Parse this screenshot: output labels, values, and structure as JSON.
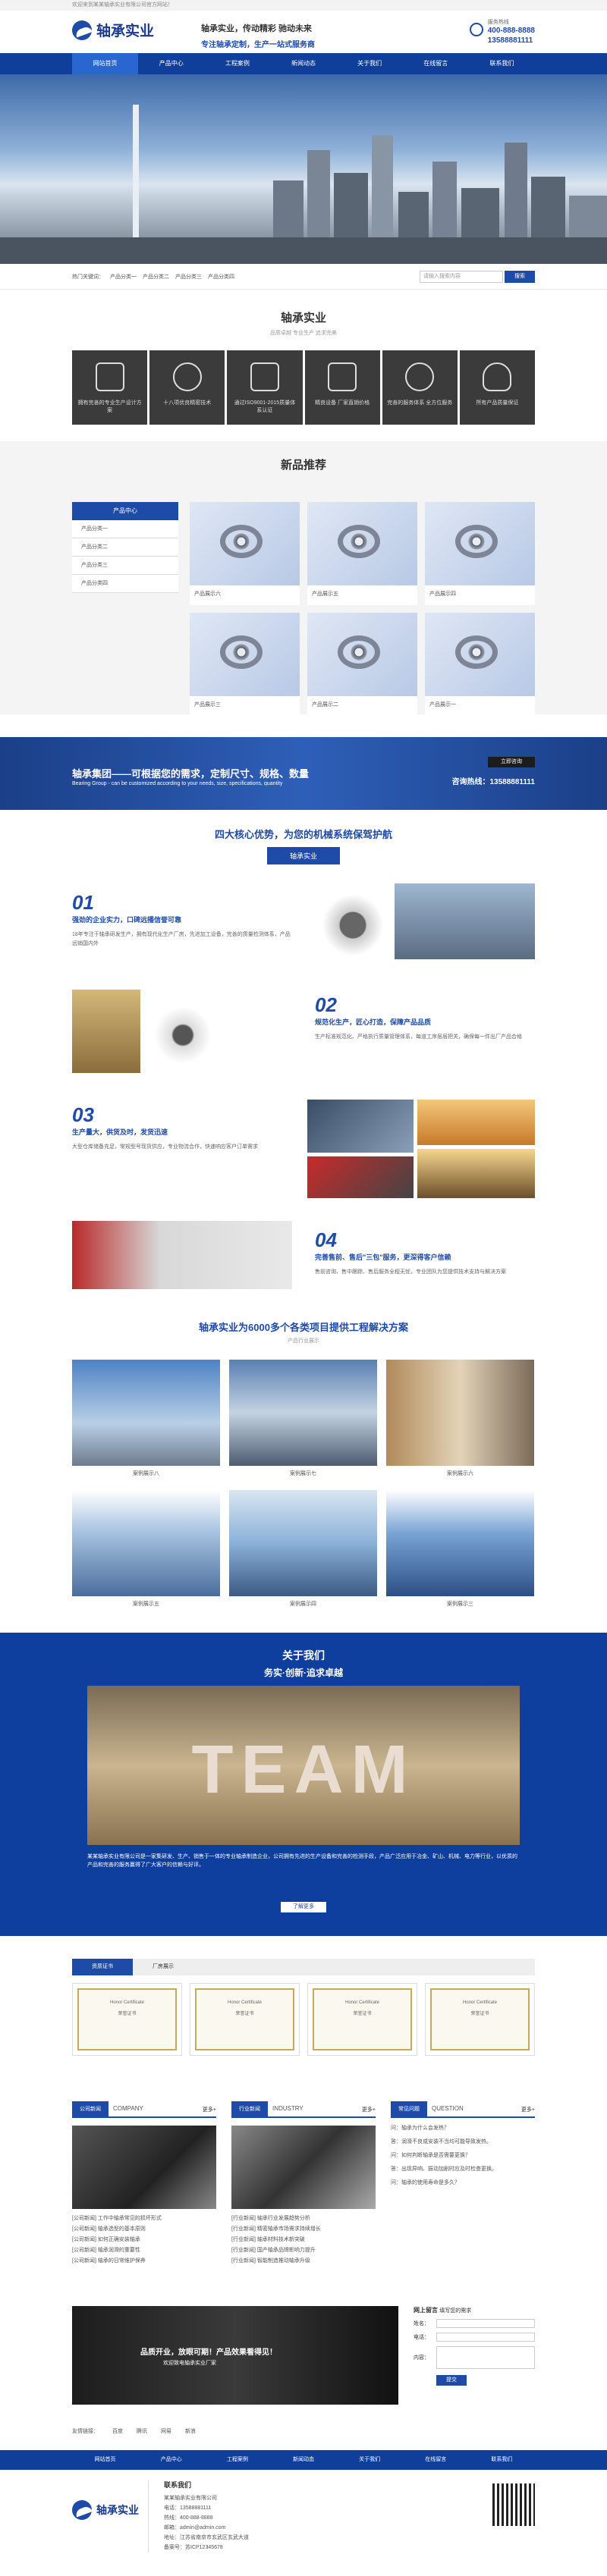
{
  "topbar": {
    "text": "欢迎来到某某轴承实业有限公司官方网站！"
  },
  "header": {
    "brand": "轴承实业",
    "slogan1": "轴承实业，传动精彩 驰动未来",
    "slogan2": "专注轴承定制，生产一站式服务商",
    "hotline_label": "服务热线",
    "phone1": "400-888-8888",
    "phone2": "13588881111"
  },
  "nav": [
    "网站首页",
    "产品中心",
    "工程案例",
    "新闻动态",
    "关于我们",
    "在线留言",
    "联系我们"
  ],
  "search": {
    "hot_label": "热门关键词：",
    "keywords": [
      "产品分类一",
      "产品分类二",
      "产品分类三",
      "产品分类四"
    ],
    "placeholder": "请输入搜索内容",
    "button": "搜索"
  },
  "intro": {
    "title": "轴承实业",
    "subtitle": "品质卓越 专业生产 追求完美",
    "features": [
      "拥有完善的专业生产设计方案",
      "十八项优良精密技术",
      "通过ISO9001-2015质量体系认证",
      "精良设备 厂家直销价格",
      "完善的服务体系 全方位服务",
      "所有产品质量保证"
    ]
  },
  "products": {
    "title": "新品推荐",
    "category_head": "产品中心",
    "categories": [
      "产品分类一",
      "产品分类二",
      "产品分类三",
      "产品分类四"
    ],
    "items": [
      "产品展示六",
      "产品展示五",
      "产品展示四",
      "产品展示三",
      "产品展示二",
      "产品展示一"
    ]
  },
  "band": {
    "title": "轴承集团——可根据您的需求，定制尺寸、规格、数量",
    "sub": "Bearing Group - can be customized according to your needs, size, specifications, quantity",
    "consult": "立即咨询",
    "phone_label": "咨询热线：",
    "phone": "13588881111"
  },
  "advantages": {
    "title": "四大核心优势，为您的机械系统保驾护航",
    "pill": "轴承实业",
    "items": [
      {
        "num": "01",
        "h": "强劲的企业实力，口碑远播信誉可靠",
        "p": "18年专注于轴承研发生产，拥有现代化生产厂房，先进加工设备，完善的质量检测体系，产品远销国内外"
      },
      {
        "num": "02",
        "h": "规范化生产，匠心打造，保障产品品质",
        "p": "生产标准规范化、严格执行质量管理体系，每道工序层层把关，确保每一件出厂产品合格"
      },
      {
        "num": "03",
        "h": "生产量大，供货及时，发货迅速",
        "p": "大型仓库储备充足，常规型号现货供应，专业物流合作，快速响应客户订单需求"
      },
      {
        "num": "04",
        "h": "完善售前、售后\"三包\"服务，更深得客户信赖",
        "p": "售前咨询、售中跟踪、售后服务全程无忧，专业团队为您提供技术支持与解决方案"
      }
    ]
  },
  "cases": {
    "title": "轴承实业为6000多个各类项目提供工程解决方案",
    "sub": "产品行业展示",
    "items": [
      "案例展示八",
      "案例展示七",
      "案例展示六",
      "案例展示五",
      "案例展示四",
      "案例展示三"
    ]
  },
  "about": {
    "title": "关于我们",
    "tag": "务实·创新·追求卓越",
    "image_text": "TEAM",
    "desc": "某某轴承实业有限公司是一家集研发、生产、销售于一体的专业轴承制造企业，公司拥有先进的生产设备和完善的检测手段，产品广泛应用于冶金、矿山、机械、电力等行业，以优质的产品和完善的服务赢得了广大客户的信赖与好评。",
    "more": "了解更多"
  },
  "honor": {
    "tabs": [
      "资质证书",
      "厂房展示"
    ],
    "cert_title": "Honor Certificate",
    "certs": [
      "荣誉证书",
      "荣誉证书",
      "荣誉证书",
      "荣誉证书"
    ]
  },
  "news": [
    {
      "t": "公司新闻",
      "en": "COMPANY",
      "more": "更多+",
      "items": [
        "[公司新闻] 工作中轴承常见的损坏形式",
        "[公司新闻] 轴承选型的基本原则",
        "[公司新闻] 如何正确安装轴承",
        "[公司新闻] 轴承润滑的重要性",
        "[公司新闻] 轴承的日常维护保养"
      ]
    },
    {
      "t": "行业新闻",
      "en": "INDUSTRY",
      "more": "更多+",
      "items": [
        "[行业新闻] 轴承行业发展趋势分析",
        "[行业新闻] 精密轴承市场需求持续增长",
        "[行业新闻] 轴承材料技术新突破",
        "[行业新闻] 国产轴承品牌影响力提升",
        "[行业新闻] 智能制造推动轴承升级"
      ]
    },
    {
      "t": "常见问题",
      "en": "QUESTION",
      "more": "更多+",
      "items": [
        "问：轴承为什么会发热？",
        "答：润滑不良或安装不当均可能导致发热。",
        "问：如何判断轴承是否需要更换？",
        "答：出现异响、振动加剧时应及时检查更换。",
        "问：轴承的使用寿命是多久？"
      ]
    }
  ],
  "message": {
    "banner1": "品质开业，放眼可期！产品效果看得见！",
    "banner2": "欢迎致电轴承实业厂家",
    "title": "网上留言",
    "sub": "填写您的需求",
    "fields": [
      "姓名：",
      "电话：",
      "内容："
    ],
    "submit": "提交"
  },
  "links": {
    "label": "友情链接：",
    "items": [
      "百度",
      "腾讯",
      "网易",
      "新浪"
    ]
  },
  "footer": {
    "brand": "轴承实业",
    "contact_title": "联系我们",
    "lines": [
      "某某轴承实业有限公司",
      "电话：13588881111",
      "热线：400-888-8888",
      "邮箱：admin@admin.com",
      "地址：江苏省南京市玄武区玄武大道",
      "备案号：苏ICP12345678"
    ]
  }
}
